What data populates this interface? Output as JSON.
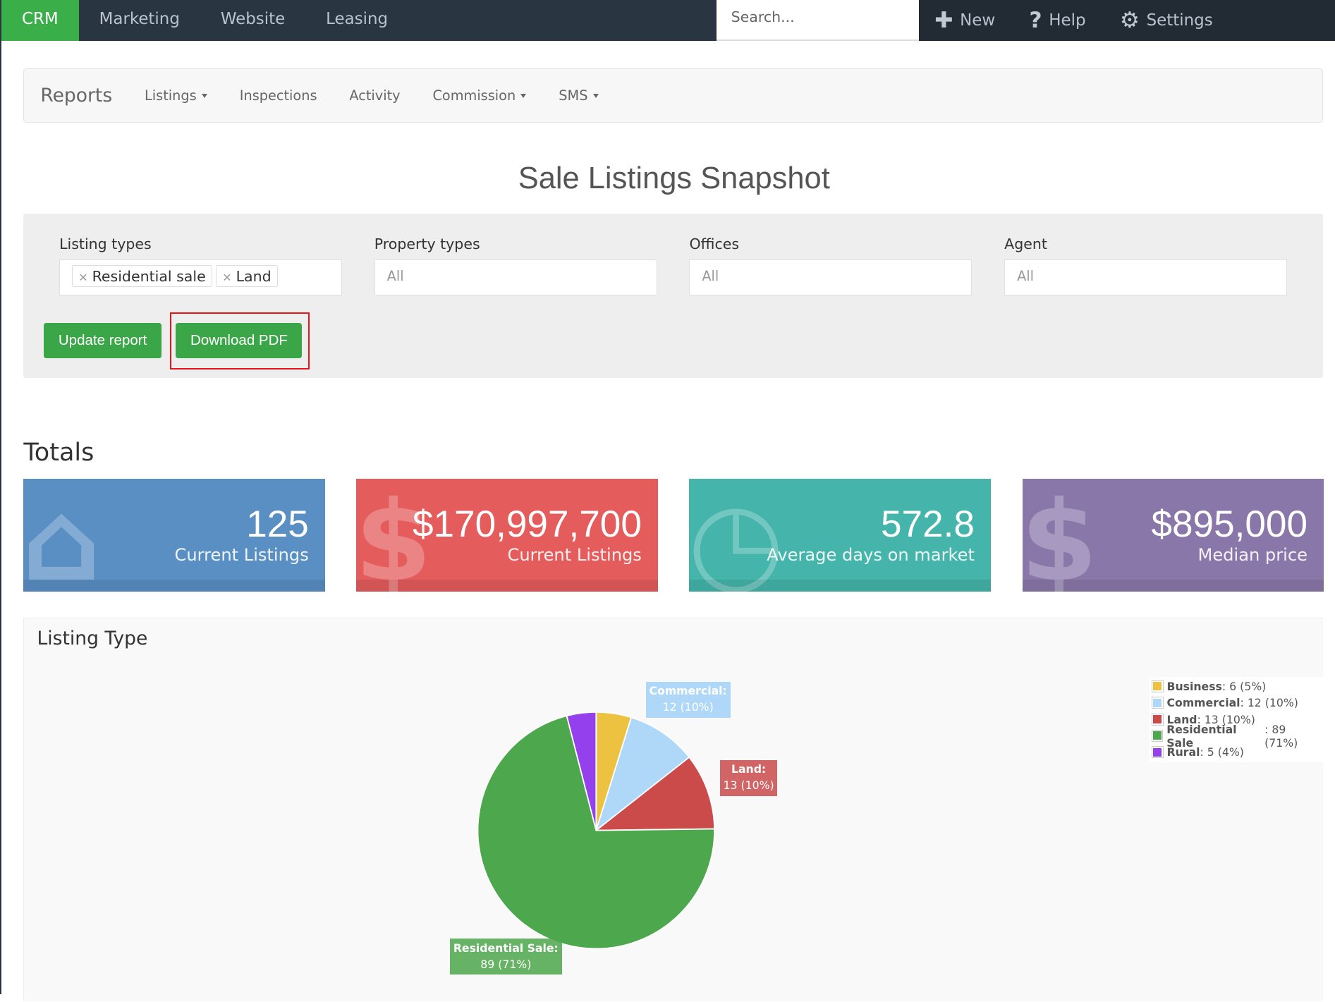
{
  "nav": {
    "items": [
      "CRM",
      "Marketing",
      "Website",
      "Leasing"
    ],
    "search_placeholder": "Search...",
    "new": "New",
    "help": "Help",
    "settings": "Settings"
  },
  "subnav": {
    "brand": "Reports",
    "items": [
      "Listings",
      "Inspections",
      "Activity",
      "Commission",
      "SMS"
    ]
  },
  "title": "Sale Listings Snapshot",
  "filters": {
    "listing_types_label": "Listing types",
    "listing_tags": [
      "Residential sale",
      "Land"
    ],
    "property_types_label": "Property types",
    "property_types_value": "All",
    "offices_label": "Offices",
    "offices_value": "All",
    "agent_label": "Agent",
    "agent_value": "All",
    "update_button": "Update report",
    "download_button": "Download PDF"
  },
  "totals": {
    "heading": "Totals",
    "cards": [
      {
        "value": "125",
        "label": "Current Listings",
        "color": "#5a8fc4"
      },
      {
        "value": "$170,997,700",
        "label": "Current Listings",
        "color": "#e45c5c"
      },
      {
        "value": "572.8",
        "label": "Average days on market",
        "color": "#45b5ac"
      },
      {
        "value": "$895,000",
        "label": "Median price",
        "color": "#8a77aa"
      }
    ]
  },
  "chart_data": {
    "type": "pie",
    "title": "Listing Type",
    "legend": "top-right",
    "categories": [
      "Business",
      "Commercial",
      "Land",
      "Residential Sale",
      "Rural"
    ],
    "values": [
      6,
      12,
      13,
      89,
      5
    ],
    "percents": [
      "5%",
      "10%",
      "10%",
      "71%",
      "4%"
    ],
    "colors": [
      "#edc240",
      "#afd8f8",
      "#cb4b4b",
      "#4da74d",
      "#9440ed"
    ],
    "legend_values": [
      ": 6 (5%)",
      ": 12 (10%)",
      ": 13 (10%)",
      ": 89 (71%)",
      ": 5 (4%)"
    ],
    "data_labels": [
      {
        "name": "Commercial:",
        "value": "12 (10%)"
      },
      {
        "name": "Land:",
        "value": "13 (10%)"
      },
      {
        "name": "Residential Sale:",
        "value": "89 (71%)"
      }
    ]
  }
}
